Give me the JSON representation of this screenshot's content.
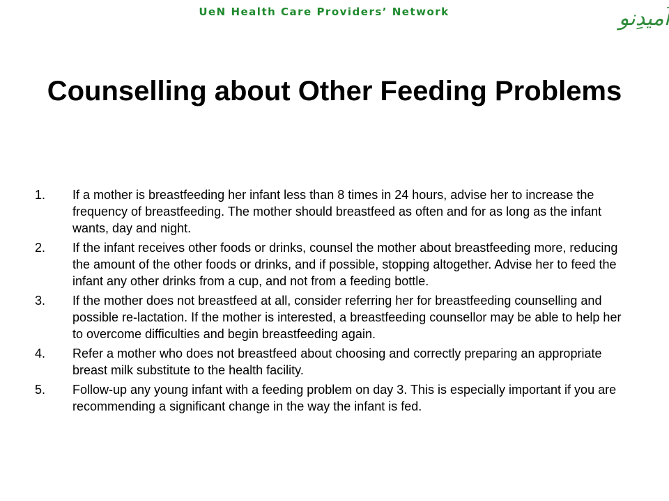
{
  "header": {
    "network_name": "UeN Health Care Providers’ Network",
    "logo_text": "اُمیدِنو"
  },
  "slide": {
    "title": "Counselling about Other Feeding Problems",
    "items": [
      {
        "number": "1.",
        "text": "If a mother is breastfeeding her infant less than 8 times in 24 hours, advise her to increase the frequency of breastfeeding.  The mother should breastfeed as often and for as long as the infant wants, day and night."
      },
      {
        "number": "2.",
        "text": "If the infant receives other foods or drinks, counsel the mother about breastfeeding more, reducing the amount of the other foods or drinks, and if possible, stopping altogether.  Advise her to feed the infant any other drinks from a cup, and not from a feeding bottle."
      },
      {
        "number": "3.",
        "text": "If the mother does not breastfeed at all, consider referring her for breastfeeding counselling and possible re-lactation.  If the mother is interested, a breastfeeding counsellor may be able to help her to overcome difficulties and begin breastfeeding again."
      },
      {
        "number": "4.",
        "text": "Refer a mother who does not breastfeed about choosing and correctly preparing an appropriate breast milk substitute to the health facility."
      },
      {
        "number": "5.",
        "text": "Follow-up any young infant with a feeding problem on day 3.  This is especially important if you are recommending a significant change in the way the infant is fed."
      }
    ]
  },
  "colors": {
    "network_green": "#1f8a2e",
    "logo_green": "#2e8b3a",
    "text": "#000000",
    "background": "#ffffff"
  }
}
